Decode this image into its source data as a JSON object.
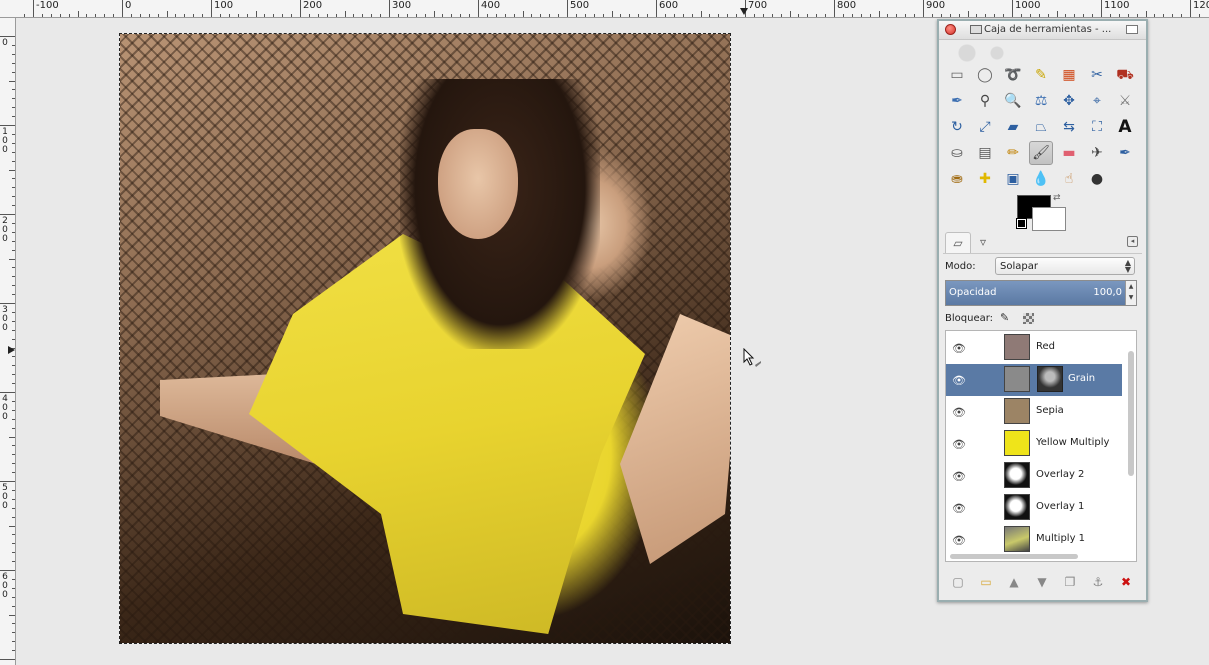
{
  "ruler": {
    "h_labels": [
      "-100",
      "0",
      "100",
      "200",
      "300",
      "400",
      "500",
      "600",
      "700",
      "800",
      "900",
      "1000",
      "1100",
      "120"
    ],
    "v_labels": [
      "0",
      "100",
      "200",
      "300",
      "400",
      "500",
      "600"
    ]
  },
  "canvas": {
    "image_description_icons": [
      "photo-sepia-woman-chair"
    ]
  },
  "toolbox": {
    "title": "Caja de herramientas - ...",
    "tools": [
      {
        "name": "rect-select-icon",
        "glyph": "▭",
        "color": "#666666"
      },
      {
        "name": "ellipse-select-icon",
        "glyph": "◯",
        "color": "#666666"
      },
      {
        "name": "free-select-icon",
        "glyph": "➰",
        "color": "#666666"
      },
      {
        "name": "fuzzy-select-icon",
        "glyph": "✎",
        "color": "#c9a500"
      },
      {
        "name": "select-by-color-icon",
        "glyph": "▦",
        "color": "#d04a1a"
      },
      {
        "name": "scissors-select-icon",
        "glyph": "✂",
        "color": "#2d5fa0"
      },
      {
        "name": "foreground-select-icon",
        "glyph": "⛟",
        "color": "#b03020"
      },
      {
        "name": "paths-icon",
        "glyph": "✒",
        "color": "#3a6db0"
      },
      {
        "name": "color-picker-icon",
        "glyph": "⚲",
        "color": "#444444"
      },
      {
        "name": "zoom-icon",
        "glyph": "🔍",
        "color": "#2d5fa0"
      },
      {
        "name": "measure-icon",
        "glyph": "⚖",
        "color": "#3a6db0"
      },
      {
        "name": "move-icon",
        "glyph": "✥",
        "color": "#2d5fa0"
      },
      {
        "name": "align-icon",
        "glyph": "⌖",
        "color": "#2d5fa0"
      },
      {
        "name": "crop-icon",
        "glyph": "⚔",
        "color": "#777777"
      },
      {
        "name": "rotate-icon",
        "glyph": "↻",
        "color": "#2d5fa0"
      },
      {
        "name": "scale-icon",
        "glyph": "⤢",
        "color": "#2d5fa0"
      },
      {
        "name": "shear-icon",
        "glyph": "▰",
        "color": "#2d5fa0"
      },
      {
        "name": "perspective-icon",
        "glyph": "⏢",
        "color": "#2d5fa0"
      },
      {
        "name": "flip-icon",
        "glyph": "⇆",
        "color": "#2d5fa0"
      },
      {
        "name": "cage-icon",
        "glyph": "⛶",
        "color": "#2d5fa0"
      },
      {
        "name": "text-icon",
        "glyph": "A",
        "color": "#111111"
      },
      {
        "name": "bucket-fill-icon",
        "glyph": "⛀",
        "color": "#555555"
      },
      {
        "name": "blend-icon",
        "glyph": "▤",
        "color": "#555555"
      },
      {
        "name": "pencil-icon",
        "glyph": "✏",
        "color": "#c08000"
      },
      {
        "name": "paintbrush-icon",
        "glyph": "🖌",
        "color": "#444444"
      },
      {
        "name": "eraser-icon",
        "glyph": "▬",
        "color": "#e06070"
      },
      {
        "name": "airbrush-icon",
        "glyph": "✈",
        "color": "#444444"
      },
      {
        "name": "ink-icon",
        "glyph": "✒",
        "color": "#2d5fa0"
      },
      {
        "name": "clone-icon",
        "glyph": "⛂",
        "color": "#a06a10"
      },
      {
        "name": "heal-icon",
        "glyph": "✚",
        "color": "#e0b800"
      },
      {
        "name": "perspective-clone-icon",
        "glyph": "▣",
        "color": "#2d5fa0"
      },
      {
        "name": "blur-icon",
        "glyph": "💧",
        "color": "#3a6db0"
      },
      {
        "name": "smudge-icon",
        "glyph": "☝",
        "color": "#c08040"
      },
      {
        "name": "dodge-burn-icon",
        "glyph": "●",
        "color": "#333333"
      }
    ],
    "active_tool": "paintbrush-icon",
    "tabs": [
      "layers-tab",
      "tool-options-tab"
    ],
    "mode_label": "Modo:",
    "mode_value": "Solapar",
    "opacity_label": "Opacidad",
    "opacity_value": "100,0",
    "opacity_fraction": 1.0,
    "lock_label": "Bloquear:",
    "layers": [
      {
        "name": "Red",
        "thumb": "#8f7a76",
        "visible": true,
        "selected": false,
        "mask": false
      },
      {
        "name": "Grain",
        "thumb": "#8a8a8a",
        "visible": true,
        "selected": true,
        "mask": true
      },
      {
        "name": "Sepia",
        "thumb": "#9c8465",
        "visible": true,
        "selected": false,
        "mask": false
      },
      {
        "name": "Yellow Multiply",
        "thumb": "#efe41a",
        "visible": true,
        "selected": false,
        "mask": false
      },
      {
        "name": "Overlay 2",
        "thumb": "bw",
        "visible": true,
        "selected": false,
        "mask": false
      },
      {
        "name": "Overlay 1",
        "thumb": "bw",
        "visible": true,
        "selected": false,
        "mask": false
      },
      {
        "name": "Multiply 1",
        "thumb": "photo",
        "visible": true,
        "selected": false,
        "mask": false
      }
    ],
    "bottom_buttons": [
      {
        "name": "new-layer-icon",
        "glyph": "▢"
      },
      {
        "name": "new-group-icon",
        "glyph": "▭"
      },
      {
        "name": "raise-layer-icon",
        "glyph": "▲"
      },
      {
        "name": "lower-layer-icon",
        "glyph": "▼"
      },
      {
        "name": "duplicate-layer-icon",
        "glyph": "❐"
      },
      {
        "name": "anchor-layer-icon",
        "glyph": "⚓"
      },
      {
        "name": "delete-layer-icon",
        "glyph": "✖"
      }
    ],
    "colors": {
      "selection": "#5a7aa5",
      "delete": "#cc1111",
      "foreground": "#000000",
      "background": "#ffffff"
    }
  }
}
